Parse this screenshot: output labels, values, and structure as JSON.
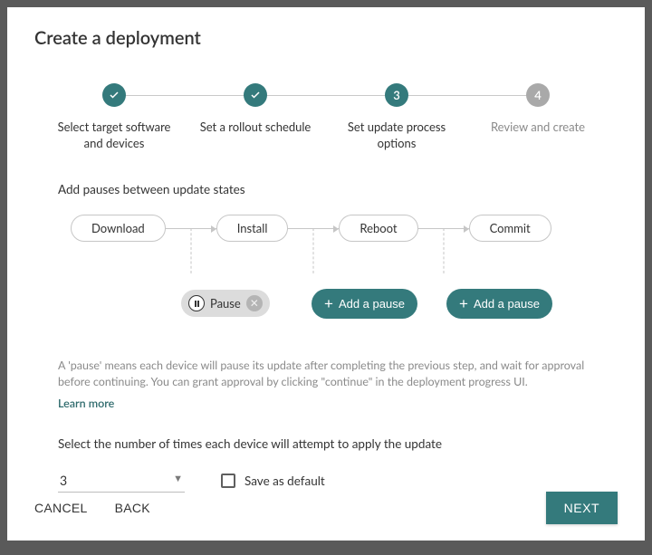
{
  "title": "Create a deployment",
  "stepper": {
    "steps": [
      {
        "label": "Select target software and devices",
        "state": "done"
      },
      {
        "label": "Set a rollout schedule",
        "state": "done"
      },
      {
        "label": "Set update process options",
        "state": "active",
        "num": "3"
      },
      {
        "label": "Review and create",
        "state": "pending",
        "num": "4"
      }
    ]
  },
  "pauses": {
    "heading": "Add pauses between update states",
    "states": [
      "Download",
      "Install",
      "Reboot",
      "Commit"
    ],
    "chip_label": "Pause",
    "add_label": "Add a pause",
    "help": "A 'pause' means each device will pause its update after completing the previous step, and wait for approval before continuing.  You can grant approval by clicking \"continue\" in the deployment progress UI.",
    "learn_more": "Learn more"
  },
  "retries": {
    "heading": "Select the number of times each device will attempt to apply the update",
    "value": "3",
    "save_default": "Save as default"
  },
  "footer": {
    "cancel": "CANCEL",
    "back": "BACK",
    "next": "NEXT"
  }
}
